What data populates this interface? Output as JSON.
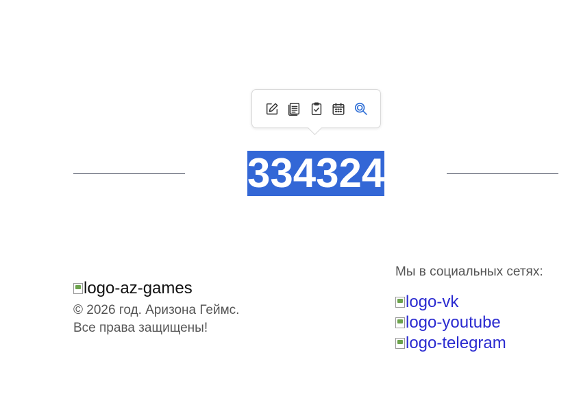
{
  "toolbar": {
    "tools": [
      {
        "icon": "edit-icon",
        "color": "#333333"
      },
      {
        "icon": "document-icon",
        "color": "#333333"
      },
      {
        "icon": "clipboard-check-icon",
        "color": "#333333"
      },
      {
        "icon": "calendar-icon",
        "color": "#333333"
      },
      {
        "icon": "search-icon",
        "color": "#2f6fd6"
      }
    ]
  },
  "main": {
    "code": "334324",
    "highlight_color": "#3367d6"
  },
  "footer": {
    "logo_alt": "logo-az-games",
    "copyright_line1": "© 2026 год. Аризона Геймс.",
    "copyright_line2": "Все права защищены!",
    "social_title": "Мы в социальных сетях:",
    "social_links": [
      "logo-vk",
      "logo-youtube",
      "logo-telegram"
    ],
    "link_color": "#2a2ad0"
  }
}
